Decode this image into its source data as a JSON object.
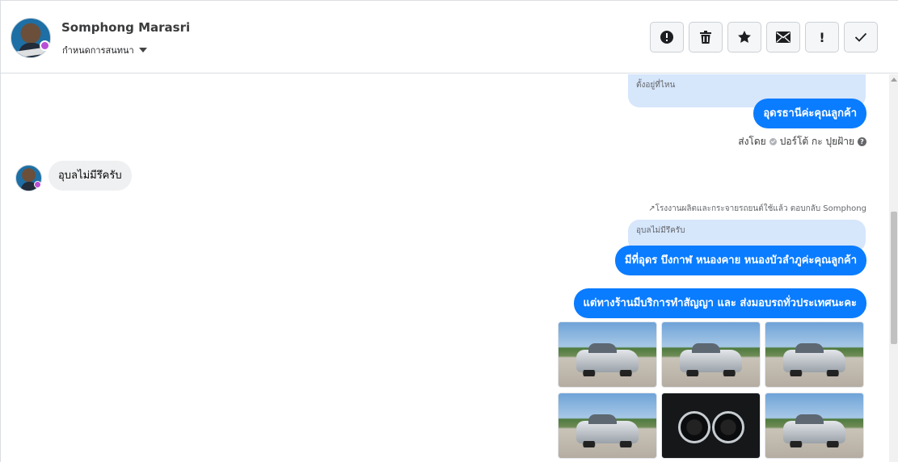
{
  "header": {
    "contact_name": "Somphong Marasri",
    "assign_label": "กำหนดการสนทนา"
  },
  "toolbar": {
    "buttons": [
      {
        "name": "alert-icon",
        "label": "mark spam"
      },
      {
        "name": "trash-icon",
        "label": "delete"
      },
      {
        "name": "star-icon",
        "label": "star"
      },
      {
        "name": "envelope-icon",
        "label": "mark unread"
      },
      {
        "name": "exclamation-icon",
        "label": "mark important"
      },
      {
        "name": "check-icon",
        "label": "done"
      }
    ],
    "important_glyph": "!"
  },
  "messages": {
    "quote_1": "ตั้งอยู่ที่ไหน",
    "reply_1": "อุดรธานีค่ะคุณลูกค้า",
    "sent_by_label": "ส่งโดย",
    "sent_by_name": "ปอร์โต้ กะ ปุยฝ้าย",
    "help_glyph": "?",
    "incoming_1": "อุบลไม่มีรึครับ",
    "reply_note": "↗โรงงานผลิตและกระจายรถยนต์ใช้แล้ว ตอบกลับ Somphong",
    "quote_2": "อุบลไม่มีรึครับ",
    "reply_2": "มีที่อุดร บึงกาฬ หนองคาย หนองบัวลำภูค่ะคุณลูกค้า",
    "reply_3": "แต่ทางร้านมีบริการทำสัญญา และ ส่งมอบรถทั่วประเทศนะคะ"
  },
  "photos": [
    {
      "name": "photo-car-front"
    },
    {
      "name": "photo-car-rear"
    },
    {
      "name": "photo-car-back"
    },
    {
      "name": "photo-car-side"
    },
    {
      "name": "photo-dashboard-gauges"
    },
    {
      "name": "photo-car-front-right"
    }
  ],
  "colors": {
    "accent": "#0a7cff",
    "quote_bg": "#d6e6fb",
    "incoming_bg": "#eff0f2",
    "badge": "#b94fd6"
  }
}
